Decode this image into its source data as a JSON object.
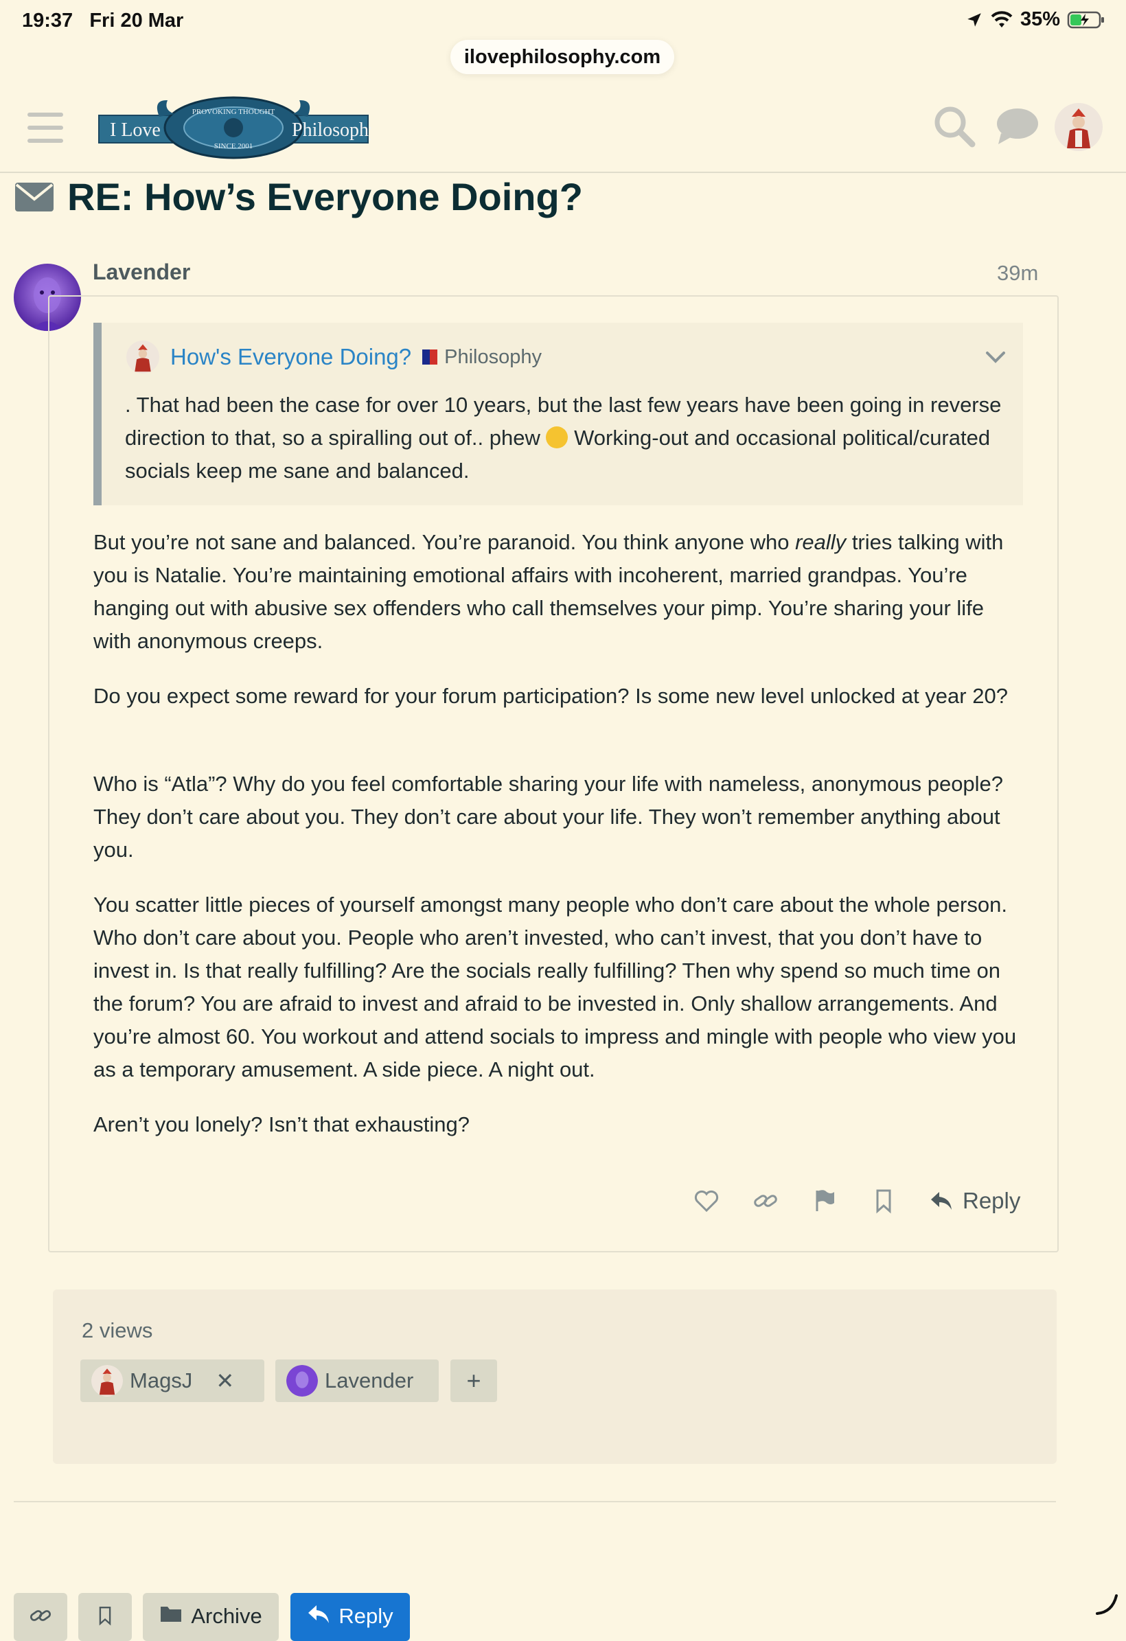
{
  "status_bar": {
    "time": "19:37",
    "date": "Fri 20 Mar",
    "battery": "35%"
  },
  "browser": {
    "url": "ilovephilosophy.com"
  },
  "header": {
    "logo_text_left": "I Love",
    "logo_text_right": "Philosophy",
    "logo_ring_top": "PROVOKING THOUGHT",
    "logo_ring_bottom": "SINCE 2001",
    "icons": [
      "hamburger-menu-icon",
      "search-icon",
      "chat-icon",
      "user-avatar"
    ]
  },
  "topic": {
    "title": "RE: How’s Everyone Doing?",
    "icon": "envelope-icon"
  },
  "post": {
    "username": "Lavender",
    "age": "39m",
    "quote": {
      "topic_link": "How's Everyone Doing?",
      "category": "Philosophy",
      "text_before_emoji": ". That had been the case for over 10 years, but the last few years have been going in reverse direction to that, so a spiralling out of.. phew",
      "text_after_emoji": "Working-out and occasional political/curated socials keep me sane and balanced."
    },
    "p1_before": "But you’re not sane and balanced. You’re paranoid. You think anyone who",
    "p1_em": "really",
    "p1_after": "tries talking with you is Natalie. You’re maintaining emotional affairs with incoherent, married grandpas. You’re hanging out with abusive sex offenders who call themselves your pimp. You’re sharing your life with anonymous creeps.",
    "p2": "Do you expect some reward for your forum participation? Is some new level unlocked at year 20?",
    "p3": "Who is “Atla”? Why do you feel comfortable sharing your life with nameless, anonymous people? They don’t care about you. They don’t care about your life. They won’t remember anything about you.",
    "p4": "You scatter little pieces of yourself amongst many people who don’t care about the whole person. Who don’t care about you. People who aren’t invested, who can’t invest, that you don’t have to invest in. Is that really fulfilling? Are the socials really fulfilling? Then why spend so much time on the forum? You are afraid to invest and afraid to be invested in. Only shallow arrangements. And you’re almost 60. You workout and attend socials to impress and mingle with people who view you as a temporary amusement. A side piece. A night out.",
    "p5": "Aren’t you lonely? Isn’t that exhausting?",
    "actions": {
      "reply_label": "Reply"
    }
  },
  "participants": {
    "views": "2 views",
    "users": [
      {
        "name": "MagsJ"
      },
      {
        "name": "Lavender"
      }
    ],
    "add_label": "+"
  },
  "footer": {
    "archive_label": "Archive",
    "reply_label": "Reply"
  },
  "colors": {
    "background": "#fcf6e2",
    "link": "#2a84c6",
    "primary": "#1775d1",
    "title": "#0c2d33"
  }
}
